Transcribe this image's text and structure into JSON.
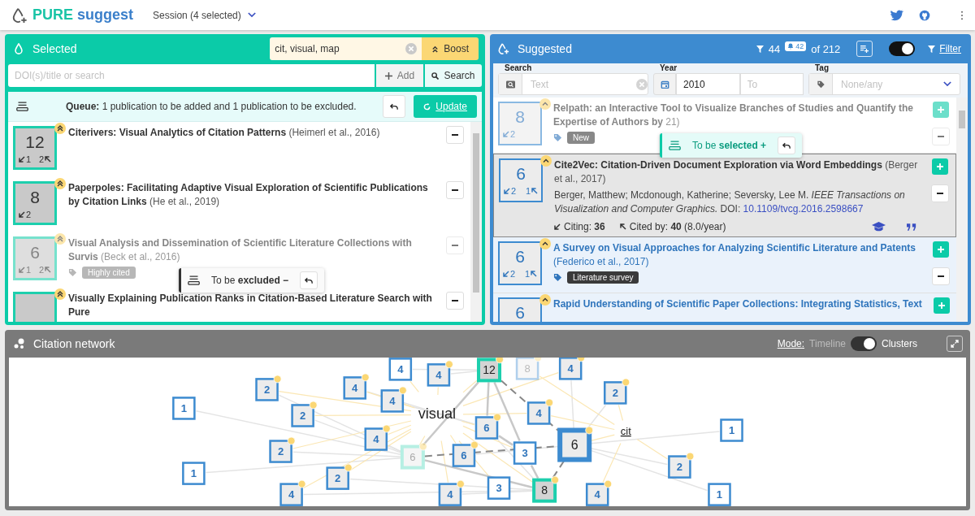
{
  "header": {
    "app_name": {
      "first": "PURE",
      "second": "suggest"
    },
    "session": "Session (4 selected)"
  },
  "selected": {
    "title": "Selected",
    "boost": {
      "value": "cit, visual, map",
      "button": "Boost"
    },
    "add": {
      "placeholder": "DOI(s)/title or search",
      "add_button": "Add",
      "search_button": "Search"
    },
    "queue": {
      "text": "**Queue:** 1 publication to be added and 1 publication to be excluded.",
      "update_button": "Update"
    },
    "items": [
      {
        "score": "12",
        "citing": "1",
        "cited": "2",
        "title": "Citerivers: Visual Analytics of Citation Patterns",
        "meta": "(Heimerl et al., 2016)",
        "boosted": true,
        "queued": false
      },
      {
        "score": "8",
        "citing": "2",
        "title": "Paperpoles: Facilitating Adaptive Visual Exploration of Scientific Publications by Citation Links",
        "meta": "(He et al., 2019)",
        "boosted": true,
        "queued": false
      },
      {
        "score": "6",
        "citing": "1",
        "cited": "2",
        "title": "Visual Analysis and Dissemination of Scientific Literature Collections with Survis",
        "meta": "(Beck et al., 2016)",
        "tag": "Highly cited",
        "boosted": true,
        "queued": true,
        "queue_label": "To be **excluded −**"
      },
      {
        "title": "Visually Explaining Publication Ranks in Citation-Based Literature Search with Pure",
        "boosted": true,
        "queued": false
      }
    ]
  },
  "suggested": {
    "title": "Suggested",
    "filtered": "44",
    "unread": "42",
    "total": "of 212",
    "toggle_on": true,
    "filter_button": "Filter",
    "filters": {
      "search_label": "Search",
      "search_placeholder": "Text",
      "year_label": "Year",
      "year_from": "2010",
      "year_to_placeholder": "To",
      "tag_label": "Tag",
      "tag_placeholder": "None/any"
    },
    "items": [
      {
        "score": "8",
        "citing": "2",
        "title": "Relpath: an Interactive Tool to Visualize Branches of Studies and Quantify the Expertise of Authors by",
        "meta": "21)",
        "tag": "New",
        "boosted": true,
        "queued": true,
        "queue_label": "To be **selected +**",
        "selected": false,
        "exclude_shown": true
      },
      {
        "score": "6",
        "citing": "2",
        "cited": "1",
        "title": "Cite2Vec: Citation-Driven Document Exploration via Word Embeddings",
        "meta": "(Berger et al., 2017)",
        "boosted": true,
        "queued": false,
        "selected": true,
        "authors": "Berger, Matthew; Mcdonough, Katherine; Seversky, Lee M.",
        "journal": "IEEE Transactions on Visualization and Computer Graphics.",
        "doi_label": "DOI:",
        "doi": "10.1109/tvcg.2016.2598667",
        "citing_text": "Citing: **36**",
        "cited_text": "Cited by: **40** (8.0/year)",
        "exclude_shown": true
      },
      {
        "score": "6",
        "citing": "2",
        "cited": "1",
        "title": "A Survey on Visual Approaches for Analyzing Scientific Literature and Patents",
        "meta": "(Federico et al., 2017)",
        "tag": "Literature survey",
        "boosted": true,
        "queued": false,
        "selected": false,
        "exclude_shown": true
      },
      {
        "score": "6",
        "title": "Rapid Understanding of Scientific Paper Collections: Integrating Statistics, Text",
        "boosted": true,
        "queued": false,
        "selected": false,
        "exclude_shown": false
      }
    ]
  },
  "network": {
    "title": "Citation network",
    "mode_label": "Mode:",
    "mode_options": [
      "Timeline",
      "Clusters"
    ],
    "clusters": true,
    "keywords": [
      "visual",
      "cit"
    ],
    "nodes": [
      {
        "label": "4",
        "kind": "suggested",
        "boosted": false
      },
      {
        "label": "4",
        "kind": "suggested",
        "boosted": true
      },
      {
        "label": "12",
        "kind": "selected",
        "boosted": true
      },
      {
        "label": "8",
        "kind": "queued_add",
        "boosted": true
      },
      {
        "label": "4",
        "kind": "suggested",
        "boosted": true
      },
      {
        "label": "2",
        "kind": "suggested",
        "boosted": true
      },
      {
        "label": "4",
        "kind": "suggested",
        "boosted": true
      },
      {
        "label": "4",
        "kind": "suggested",
        "boosted": true
      },
      {
        "label": "2",
        "kind": "suggested",
        "boosted": true
      },
      {
        "label": "1",
        "kind": "suggested",
        "boosted": false
      },
      {
        "label": "2",
        "kind": "suggested",
        "boosted": true
      },
      {
        "label": "4",
        "kind": "suggested",
        "boosted": true
      },
      {
        "label": "6",
        "kind": "suggested",
        "boosted": true
      },
      {
        "label": "4",
        "kind": "suggested",
        "boosted": true
      },
      {
        "label": "6",
        "kind": "active",
        "boosted": true
      },
      {
        "label": "1",
        "kind": "suggested",
        "boosted": false
      },
      {
        "label": "2",
        "kind": "suggested",
        "boosted": true
      },
      {
        "label": "6",
        "kind": "queued_remove",
        "boosted": true
      },
      {
        "label": "6",
        "kind": "suggested",
        "boosted": true
      },
      {
        "label": "3",
        "kind": "suggested",
        "boosted": false
      },
      {
        "label": "2",
        "kind": "suggested",
        "boosted": true
      },
      {
        "label": "1",
        "kind": "suggested",
        "boosted": false
      },
      {
        "label": "2",
        "kind": "suggested",
        "boosted": true
      },
      {
        "label": "3",
        "kind": "suggested",
        "boosted": false
      },
      {
        "label": "8",
        "kind": "selected",
        "boosted": true
      },
      {
        "label": "4",
        "kind": "suggested",
        "boosted": true
      },
      {
        "label": "4",
        "kind": "suggested",
        "boosted": true
      },
      {
        "label": "4",
        "kind": "suggested",
        "boosted": true
      },
      {
        "label": "1",
        "kind": "suggested",
        "boosted": false
      }
    ]
  }
}
